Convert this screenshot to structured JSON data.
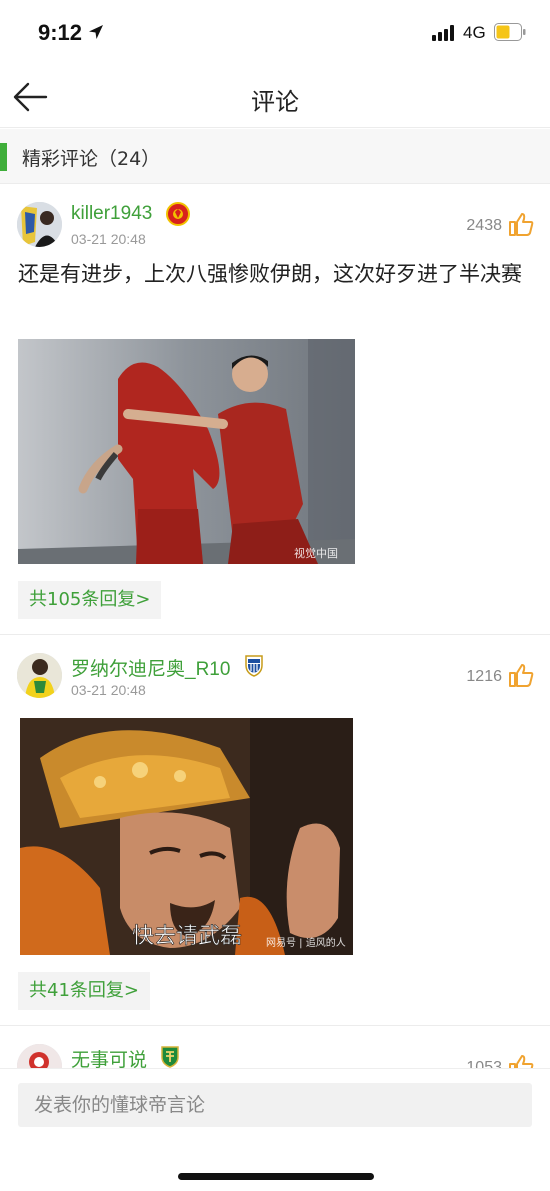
{
  "status_bar": {
    "time": "9:12",
    "network": "4G"
  },
  "nav": {
    "title": "评论",
    "back_icon": "arrow-left-icon"
  },
  "section": {
    "title": "精彩评论（24）",
    "accent_color": "#3fae3a"
  },
  "comments": [
    {
      "username": "killer1943",
      "badge_icon": "manchester-united-badge-icon",
      "timestamp": "03-21 20:48",
      "likes": "2438",
      "text": "还是有进步，上次八强惨败伊朗，这次好歹进了半决赛",
      "image_description_icon": "football-players-photo",
      "image_watermark": "视觉中国",
      "replies": "共105条回复>"
    },
    {
      "username": "罗纳尔迪尼奥_R10",
      "badge_icon": "espanyol-badge-icon",
      "timestamp": "03-21 20:48",
      "likes": "1216",
      "image_caption": "快去请武磊",
      "image_watermark": "网易号 | 追风的人",
      "replies": "共41条回复>"
    },
    {
      "username": "无事可说",
      "badge_icon": "beijing-guoan-badge-icon",
      "likes": "1053"
    }
  ],
  "input": {
    "placeholder": "发表你的懂球帝言论"
  },
  "colors": {
    "green": "#3fa03a",
    "like_orange": "#f0a330"
  }
}
